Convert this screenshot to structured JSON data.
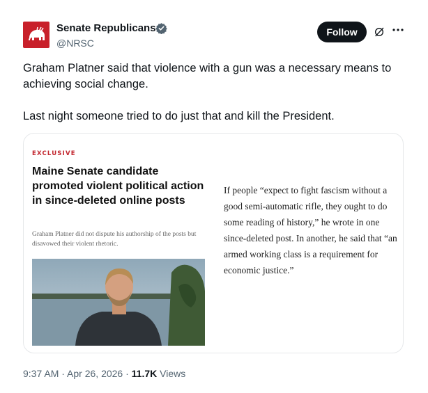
{
  "account": {
    "name": "Senate Republicans",
    "handle": "@NRSC"
  },
  "header": {
    "follow_label": "Follow"
  },
  "tweet": {
    "text": "Graham Platner said that violence with a gun was a necessary means to achieving social change.\n\nLast night someone tried to do just that and kill the President."
  },
  "card": {
    "kicker": "EXCLUSIVE",
    "headline": "Maine Senate candidate promoted violent political action in since-deleted online posts",
    "dek": "Graham Platner did not dispute his authorship of the posts but disavowed their violent rhetoric.",
    "quote": "If people “expect to fight fascism without a good semi-automatic rifle, they ought to do some reading of history,” he wrote in one since-deleted post. In another, he said that “an armed working class is a requirement for economic justice.”"
  },
  "meta": {
    "time": "9:37 AM",
    "sep1": " · ",
    "date": "Apr 26, 2026",
    "sep2": " · ",
    "views_count": "11.7K",
    "views_label": " Views"
  },
  "icons": {
    "avatar": "nrsc-elephant-logo",
    "verified": "verified-badge-icon",
    "grok": "grok-icon",
    "more": "more-icon"
  },
  "colors": {
    "brand_red": "#c8202a",
    "kicker_red": "#c2262e",
    "follow_bg": "#0f1419",
    "verified_blue": "#1d9bf0",
    "secondary_text": "#536471"
  }
}
